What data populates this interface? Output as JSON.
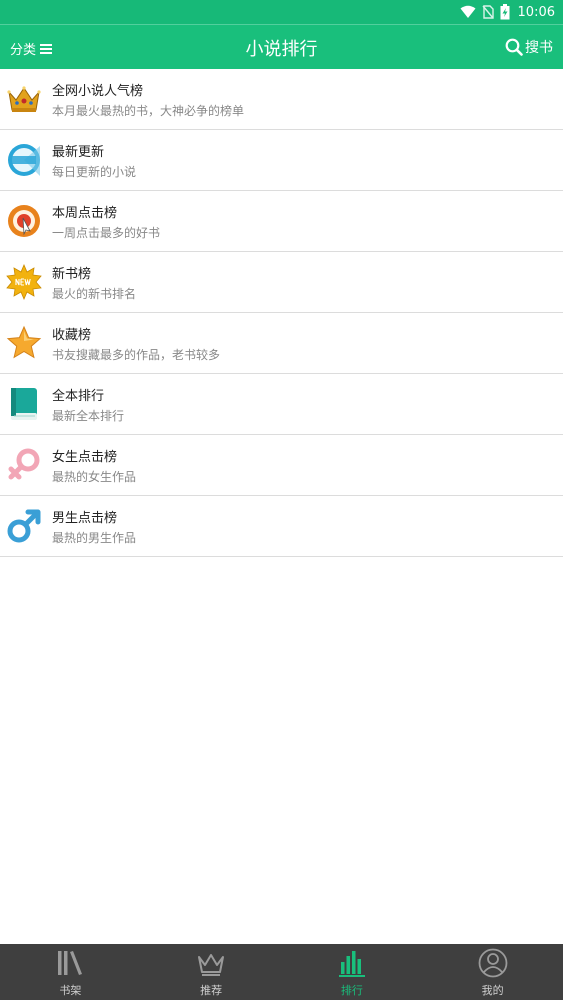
{
  "status_bar": {
    "time": "10:06",
    "bg": "#17b978"
  },
  "app_bar": {
    "left_label": "分类",
    "title": "小说排行",
    "right_label": "搜书",
    "bg": "#19bf7c"
  },
  "rankings": [
    {
      "title": "全网小说人气榜",
      "desc": "本月最火最热的书，大神必争的榜单",
      "icon": "crown-icon"
    },
    {
      "title": "最新更新",
      "desc": "每日更新的小说",
      "icon": "new-badge-icon"
    },
    {
      "title": "本周点击榜",
      "desc": "一周点击最多的好书",
      "icon": "target-click-icon"
    },
    {
      "title": "新书榜",
      "desc": "最火的新书排名",
      "icon": "new-star-burst-icon"
    },
    {
      "title": "收藏榜",
      "desc": "书友搜藏最多的作品，老书较多",
      "icon": "star-icon"
    },
    {
      "title": "全本排行",
      "desc": "最新全本排行",
      "icon": "book-icon"
    },
    {
      "title": "女生点击榜",
      "desc": "最热的女生作品",
      "icon": "female-icon"
    },
    {
      "title": "男生点击榜",
      "desc": "最热的男生作品",
      "icon": "male-icon"
    }
  ],
  "bottom_nav": {
    "items": [
      {
        "label": "书架",
        "icon": "bookshelf-icon",
        "active": false
      },
      {
        "label": "推荐",
        "icon": "crown-outline-icon",
        "active": false
      },
      {
        "label": "排行",
        "icon": "bar-chart-icon",
        "active": true
      },
      {
        "label": "我的",
        "icon": "user-icon",
        "active": false
      }
    ],
    "active_color": "#19bf7c"
  }
}
